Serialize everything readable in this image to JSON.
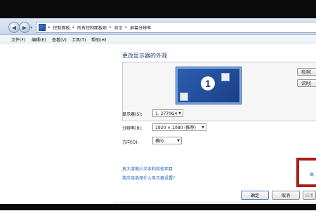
{
  "breadcrumbs": [
    "控制面板",
    "所有控制面板项",
    "显示",
    "屏幕分辨率"
  ],
  "menu": [
    "文件(F)",
    "编辑(E)",
    "查看(V)",
    "工具(T)",
    "帮助(H)"
  ],
  "content": {
    "title": "更改显示器的外观",
    "monitor_number": "1",
    "detect_button": "检测(",
    "identify_button": "识别(",
    "display_label": "显示器(S):",
    "display_value": "1. 2770G4",
    "resolution_label": "分辨率(R):",
    "resolution_value": "1920 × 1080 (推荐)",
    "orientation_label": "方向(O):",
    "orientation_value": "横向",
    "advanced_link": "高",
    "link_text_size": "放大或缩小文本和其他项目",
    "link_which_settings": "我应该选择什么显示器设置?"
  },
  "buttons": {
    "ok": "确定",
    "cancel": "取消",
    "apply": "应用"
  },
  "colors": {
    "highlight": "#b01a1a",
    "link": "#1c5cb8",
    "monitor": "#1b3f87"
  }
}
